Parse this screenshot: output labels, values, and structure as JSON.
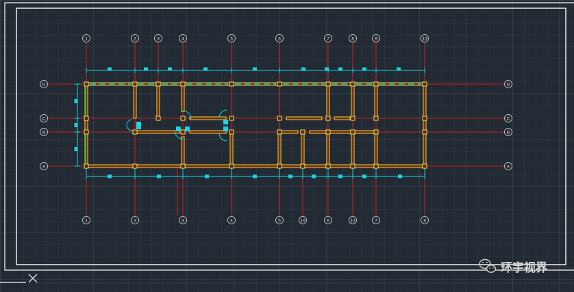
{
  "axes": {
    "top": [
      "1",
      "2",
      "3",
      "4",
      "5",
      "6",
      "7",
      "8",
      "9",
      "10"
    ],
    "bottom": [
      "1",
      "2",
      "3",
      "4",
      "5",
      "10",
      "6",
      "10",
      "7",
      "8"
    ],
    "left": [
      "D",
      "C",
      "B",
      "A"
    ],
    "right": [
      "D",
      "C",
      "B",
      "A"
    ]
  },
  "watermark": {
    "icon": "wechat-icon",
    "text": "环宇视界"
  },
  "ucs_icon": "ucs-icon",
  "colors": {
    "background": "#222a33",
    "axis": "#d42020",
    "wall": "#f2c81e",
    "column": "#ffd23a",
    "dimension": "#19d6e6",
    "window_green": "#2fe03a",
    "frame": "#ffffff",
    "watermark": "#d9d9d9"
  }
}
